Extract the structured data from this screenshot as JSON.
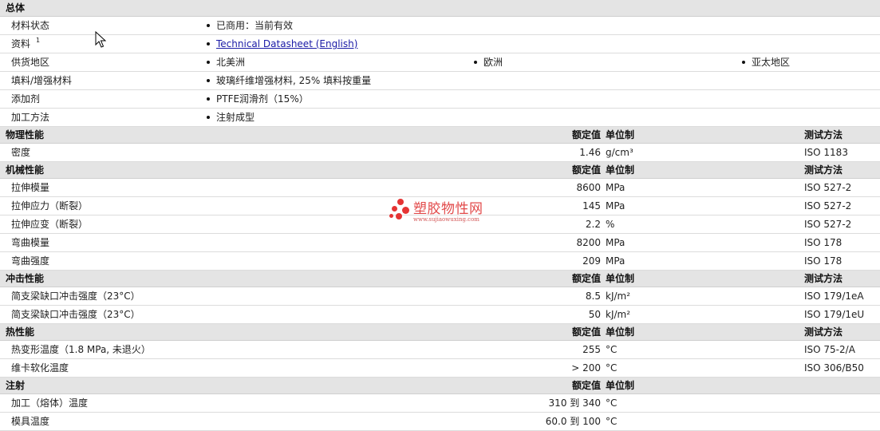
{
  "general": {
    "title": "总体",
    "rows": [
      {
        "label": "材料状态",
        "values": [
          "已商用：当前有效"
        ]
      },
      {
        "label": "资料",
        "sup": "1",
        "link": "Technical Datasheet (English)"
      },
      {
        "label": "供货地区",
        "values": [
          "北美洲",
          "欧洲",
          "亚太地区"
        ]
      },
      {
        "label": "填料/增强材料",
        "values": [
          "玻璃纤维增强材料, 25% 填料按重量"
        ]
      },
      {
        "label": "添加剂",
        "values": [
          "PTFE润滑剂（15%）"
        ]
      },
      {
        "label": "加工方法",
        "values": [
          "注射成型"
        ]
      }
    ]
  },
  "headers": {
    "value": "额定值",
    "unit": "单位制",
    "method": "测试方法"
  },
  "sections": [
    {
      "title": "物理性能",
      "rows": [
        {
          "label": "密度",
          "value": "1.46",
          "unit": "g/cm³",
          "method": "ISO 1183"
        }
      ]
    },
    {
      "title": "机械性能",
      "rows": [
        {
          "label": "拉伸模量",
          "value": "8600",
          "unit": "MPa",
          "method": "ISO 527-2"
        },
        {
          "label": "拉伸应力（断裂）",
          "value": "145",
          "unit": "MPa",
          "method": "ISO 527-2"
        },
        {
          "label": "拉伸应变（断裂）",
          "value": "2.2",
          "unit": "%",
          "method": "ISO 527-2"
        },
        {
          "label": "弯曲模量",
          "value": "8200",
          "unit": "MPa",
          "method": "ISO 178"
        },
        {
          "label": "弯曲强度",
          "value": "209",
          "unit": "MPa",
          "method": "ISO 178"
        }
      ]
    },
    {
      "title": "冲击性能",
      "rows": [
        {
          "label": "简支梁缺口冲击强度（23°C）",
          "value": "8.5",
          "unit": "kJ/m²",
          "method": "ISO 179/1eA"
        },
        {
          "label": "简支梁缺口冲击强度（23°C）",
          "value": "50",
          "unit": "kJ/m²",
          "method": "ISO 179/1eU"
        }
      ]
    },
    {
      "title": "热性能",
      "rows": [
        {
          "label": "热变形温度（1.8 MPa, 未退火）",
          "value": "255",
          "unit": "°C",
          "method": "ISO 75-2/A"
        },
        {
          "label": "维卡软化温度",
          "value": "> 200",
          "unit": "°C",
          "method": "ISO 306/B50"
        }
      ]
    },
    {
      "title": "注射",
      "noMethod": true,
      "rows": [
        {
          "label": "加工（熔体）温度",
          "value": "310 到  340",
          "unit": "°C",
          "method": ""
        },
        {
          "label": "模具温度",
          "value": "60.0 到  100",
          "unit": "°C",
          "method": ""
        }
      ]
    }
  ],
  "watermark": {
    "title": "塑胶物性网",
    "url": "www.sujiaowuxing.com"
  },
  "colors": {
    "section_bg": "#e4e4e4",
    "link": "#1a1aa6",
    "watermark": "#e53434"
  }
}
